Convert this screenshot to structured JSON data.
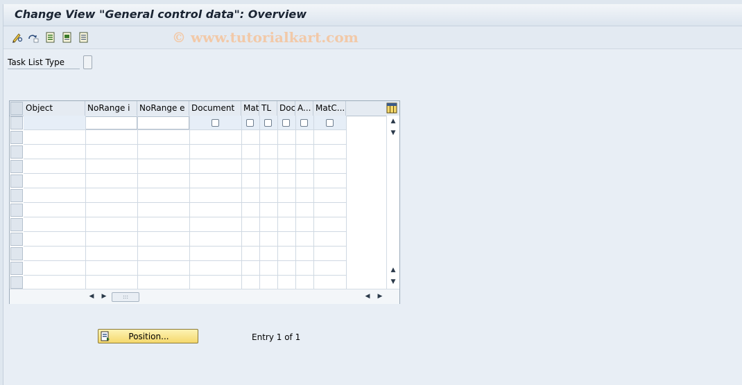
{
  "window": {
    "title": "Change View \"General control data\": Overview",
    "watermark": "© www.tutorialkart.com"
  },
  "toolbar": {
    "icons": [
      "display-change-icon",
      "other-view-icon",
      "select-all-icon",
      "select-block-icon",
      "deselect-all-icon"
    ]
  },
  "filter": {
    "task_list_type_label": "Task List Type",
    "task_list_type_value": ""
  },
  "table": {
    "columns": [
      "Object",
      "NoRange i",
      "NoRange e",
      "Document",
      "Mat",
      "TL",
      "Doc",
      "A...",
      "MatC..."
    ],
    "rows": [
      {
        "object": "",
        "norange_i": "",
        "norange_e": "",
        "document": false,
        "mat": false,
        "tl": false,
        "doc": false,
        "a": false,
        "matc": false
      }
    ]
  },
  "footer": {
    "position_button": "Position...",
    "entry_text": "Entry 1 of 1"
  },
  "colors": {
    "button_yellow": "#f5d86c",
    "frame_bg": "#e8eef5",
    "selected_row": "#e6eef7"
  }
}
